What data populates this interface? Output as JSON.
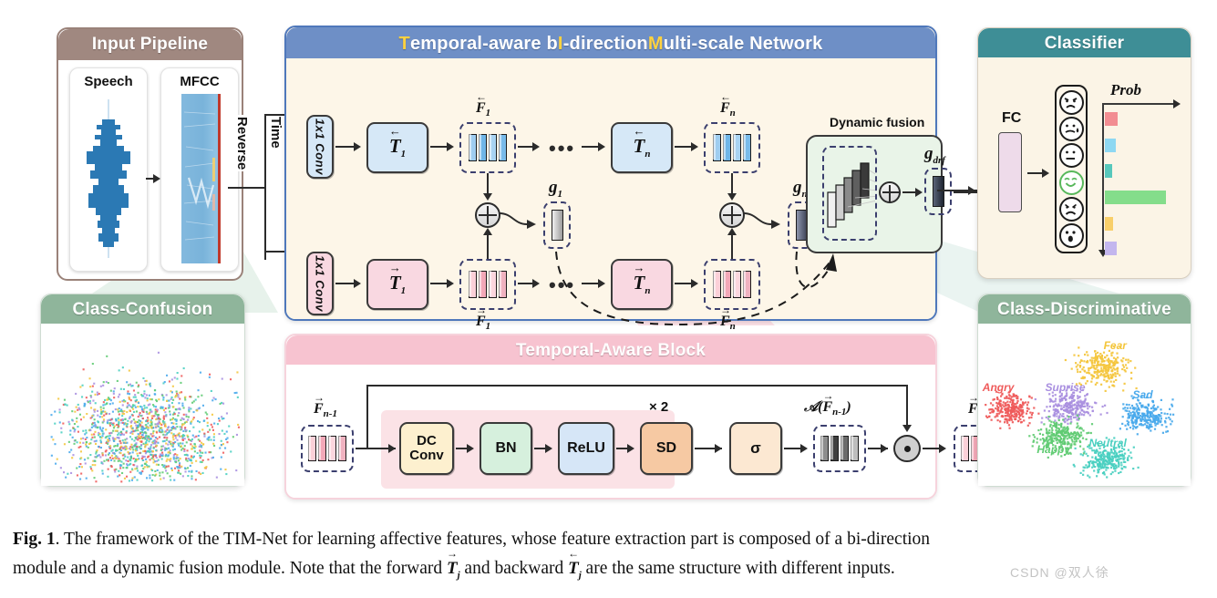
{
  "figure": {
    "caption_prefix": "Fig. 1",
    "caption_line1": ". The framework of the TIM-Net for learning affective features, whose feature extraction part is composed of a bi-direction",
    "caption_line2_a": "module and a dynamic fusion module. Note that the forward ",
    "caption_line2_b": " and backward ",
    "caption_line2_c": " are the same structure with different inputs.",
    "watermark": "CSDN @双人徐"
  },
  "input_pipeline": {
    "title": "Input Pipeline",
    "speech_label": "Speech",
    "mfcc_label": "MFCC",
    "header_color": "#a08880",
    "waveform_color": "#2b79b4"
  },
  "reverse_branch": {
    "reverse_label": "Reverse",
    "time_label": "Time"
  },
  "timnet": {
    "title_parts": [
      {
        "text": "T",
        "highlight": true
      },
      {
        "text": "emporal-aware b",
        "highlight": false
      },
      {
        "text": "I",
        "highlight": true
      },
      {
        "text": "-direction ",
        "highlight": false
      },
      {
        "text": "M",
        "highlight": true
      },
      {
        "text": "ulti-scale Network",
        "highlight": false
      }
    ],
    "title_plain": "Temporal-aware bI-direction Multi-scale Network",
    "header_color": "#6e8fc6",
    "highlight_color": "#ffd23f",
    "backward_conv_label": "1x1 Conv",
    "forward_conv_label": "1x1 Conv",
    "backward_blocks": [
      "ᵛ̃\u0001",
      "T1",
      "Tn"
    ],
    "backward_block_1": "T",
    "backward_block_1_sub": "1",
    "backward_block_n": "T",
    "backward_block_n_sub": "n",
    "forward_block_1": "T",
    "forward_block_1_sub": "1",
    "forward_block_n": "T",
    "forward_block_n_sub": "n",
    "feat_back_1": "F",
    "feat_back_1_sub": "1",
    "feat_back_n": "F",
    "feat_back_n_sub": "n",
    "feat_fwd_1": "F",
    "feat_fwd_1_sub": "1",
    "feat_fwd_n": "F",
    "feat_fwd_n_sub": "n",
    "gate_1": "g",
    "gate_1_sub": "1",
    "gate_n": "g",
    "gate_n_sub": "n",
    "gate_drf": "g",
    "gate_drf_sub": "drf",
    "dynamic_fusion_label": "Dynamic fusion",
    "ellipsis": "•••",
    "backward_color": "#d6e8f7",
    "forward_color": "#f9d8e1",
    "fusion_color": "#e9f4e8"
  },
  "temporal_aware_block": {
    "title": "Temporal-Aware Block",
    "header_color": "#f7c3d0",
    "input_label": "F",
    "input_sub": "n-1",
    "output_label": "F",
    "output_sub": "n",
    "attention_label_a": "𝒜(",
    "attention_label_f": "F",
    "attention_label_sub": "n-1",
    "attention_label_close": ")",
    "repeat_label": "× 2",
    "sigma_label": "σ",
    "stages": [
      {
        "label": "DC Conv",
        "color": "#fdf0cf"
      },
      {
        "label": "BN",
        "color": "#d6f0dd"
      },
      {
        "label": "ReLU",
        "color": "#d6e6f7"
      },
      {
        "label": "SD",
        "color": "#f6c9a3"
      }
    ]
  },
  "classifier": {
    "title": "Classifier",
    "header_color": "#3e8e96",
    "fc_label": "FC",
    "prob_label": "Prob",
    "fc_color": "#eedbea",
    "emotions": [
      {
        "face": "angry-face",
        "prob": 0.17,
        "color": "#f28d92",
        "highlighted": false
      },
      {
        "face": "worried-face",
        "prob": 0.14,
        "color": "#8ed8f2",
        "highlighted": false
      },
      {
        "face": "neutral-face",
        "prob": 0.09,
        "color": "#57c8bc",
        "highlighted": false
      },
      {
        "face": "happy-face",
        "prob": 0.8,
        "color": "#84dd8b",
        "highlighted": true
      },
      {
        "face": "sad-face",
        "prob": 0.11,
        "color": "#f8cf6a",
        "highlighted": false
      },
      {
        "face": "surprised-face",
        "prob": 0.15,
        "color": "#c3b6ee",
        "highlighted": false
      }
    ]
  },
  "class_confusion": {
    "title": "Class-Confusion",
    "header_color": "#8fb59b"
  },
  "class_discriminative": {
    "title": "Class-Discriminative",
    "header_color": "#8fb59b",
    "clusters": [
      {
        "label": "Fear",
        "color": "#f4c63c",
        "cx": 0.575,
        "cy": 0.265,
        "lx": 0.645,
        "ly": 0.135,
        "spread": 0.085
      },
      {
        "label": "Angry",
        "color": "#ef5a5a",
        "cx": 0.15,
        "cy": 0.525,
        "lx": 0.095,
        "ly": 0.395,
        "spread": 0.072
      },
      {
        "label": "Suprise",
        "color": "#a98fe0",
        "cx": 0.43,
        "cy": 0.51,
        "lx": 0.41,
        "ly": 0.395,
        "spread": 0.08
      },
      {
        "label": "Sad",
        "color": "#49a9ec",
        "cx": 0.78,
        "cy": 0.56,
        "lx": 0.775,
        "ly": 0.44,
        "spread": 0.078
      },
      {
        "label": "Happy",
        "color": "#5fcb72",
        "cx": 0.39,
        "cy": 0.69,
        "lx": 0.355,
        "ly": 0.775,
        "spread": 0.08
      },
      {
        "label": "Neutral",
        "color": "#49cfc0",
        "cx": 0.6,
        "cy": 0.83,
        "lx": 0.61,
        "ly": 0.735,
        "spread": 0.08
      }
    ]
  }
}
